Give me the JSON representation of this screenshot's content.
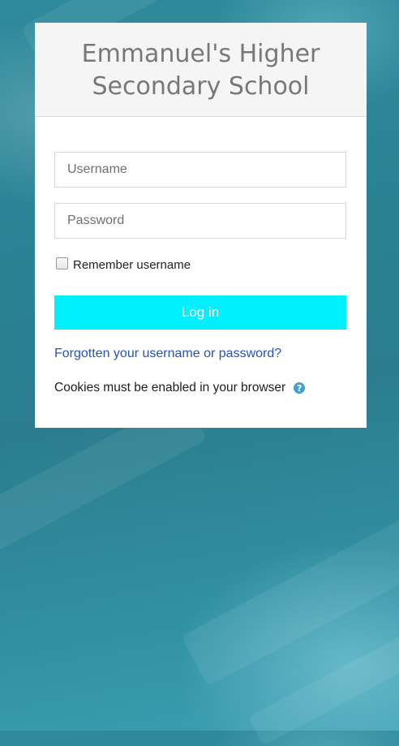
{
  "site": {
    "title": "Emmanuel's Higher Secondary School"
  },
  "login_form": {
    "username_placeholder": "Username",
    "username_value": "",
    "password_placeholder": "Password",
    "password_value": "",
    "remember_label": "Remember username",
    "remember_checked": false,
    "login_button_label": "Log in",
    "forgot_link": "Forgotten your username or password?",
    "cookies_notice": "Cookies must be enabled in your browser",
    "help_icon": "question-circle-icon"
  },
  "colors": {
    "login_button": "#00f0ff",
    "link": "#2553b8",
    "help_icon": "#3fa3cf",
    "background": "#2b7d8e"
  }
}
